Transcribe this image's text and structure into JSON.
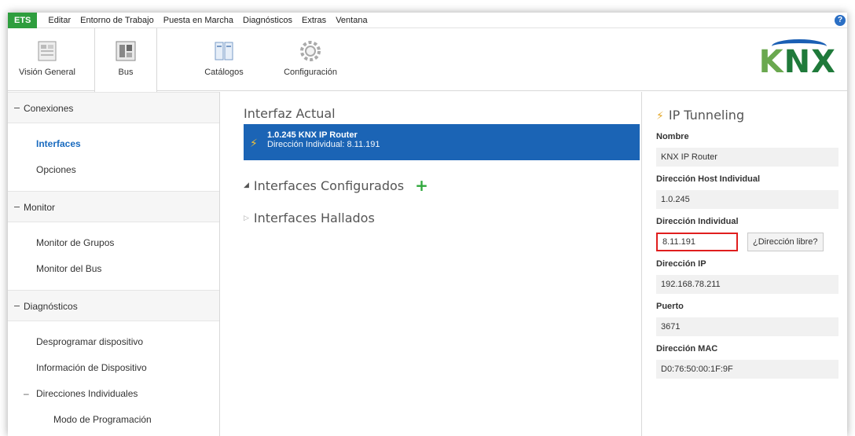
{
  "menubar": {
    "ets": "ETS",
    "items": [
      "Editar",
      "Entorno de Trabajo",
      "Puesta en Marcha",
      "Diagnósticos",
      "Extras",
      "Ventana"
    ],
    "help": "?"
  },
  "ribbon": {
    "tabs": [
      {
        "label": "Visión General",
        "icon": "overview-icon"
      },
      {
        "label": "Bus",
        "icon": "bus-icon",
        "active": true
      },
      {
        "label": "Catálogos",
        "icon": "catalog-icon"
      },
      {
        "label": "Configuración",
        "icon": "gear-icon"
      }
    ],
    "logo": "KNX"
  },
  "leftnav": {
    "sections": [
      {
        "header": "Conexiones",
        "items": [
          "Interfaces",
          "Opciones"
        ]
      },
      {
        "header": "Monitor",
        "items": [
          "Monitor de Grupos",
          "Monitor del Bus"
        ]
      },
      {
        "header": "Diagnósticos",
        "items": [
          "Desprogramar dispositivo",
          "Información de Dispositivo",
          "Direcciones Individuales",
          "Modo de Programación"
        ]
      }
    ],
    "active": "Interfaces"
  },
  "center": {
    "title": "Interfaz Actual",
    "current": {
      "name": "1.0.245 KNX IP Router",
      "detail": "Dirección Individual: 8.11.191"
    },
    "configured": "Interfaces Configurados",
    "found": "Interfaces Hallados"
  },
  "details": {
    "title": "IP Tunneling",
    "nombre_label": "Nombre",
    "nombre": "KNX IP Router",
    "host_label": "Dirección Host Individual",
    "host": "1.0.245",
    "ind_label": "Dirección Individual",
    "ind": "8.11.191",
    "free_btn": "¿Dirección libre?",
    "ip_label": "Dirección IP",
    "ip": "192.168.78.211",
    "port_label": "Puerto",
    "port": "3671",
    "mac_label": "Dirección MAC",
    "mac": "D0:76:50:00:1F:9F"
  },
  "colors": {
    "accent": "#1b64b5",
    "ets": "#2e9e3e",
    "highlight": "#e01e1e"
  }
}
